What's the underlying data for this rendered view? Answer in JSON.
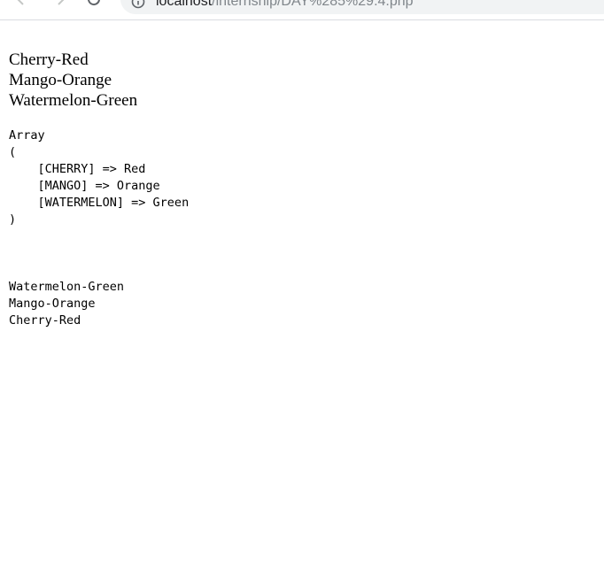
{
  "browser": {
    "url_host": "localhost",
    "url_path": "/internship/DAY%285%29.4.php"
  },
  "output": {
    "echo_lines": [
      "Cherry-Red",
      "Mango-Orange",
      "Watermelon-Green"
    ],
    "print_r": {
      "header": "Array",
      "open": "(",
      "entries": [
        "    [CHERRY] => Red",
        "    [MANGO] => Orange",
        "    [WATERMELON] => Green"
      ],
      "close": ")"
    },
    "sorted_lines": [
      "Watermelon-Green",
      "Mango-Orange",
      "Cherry-Red"
    ]
  }
}
